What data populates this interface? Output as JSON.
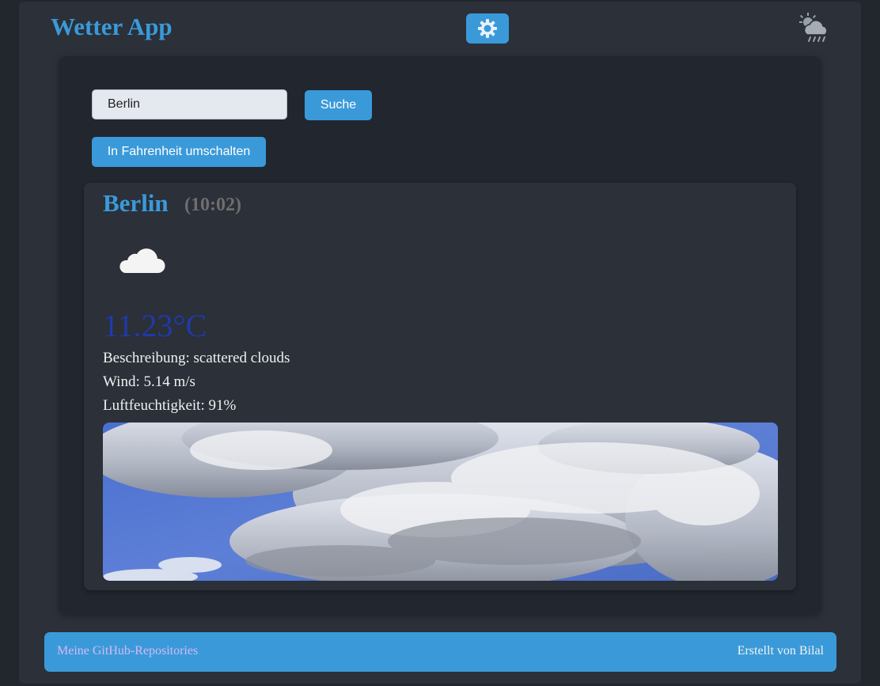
{
  "header": {
    "title": "Wetter App",
    "theme_toggle_icon": "sun-gear-icon",
    "weather_icon": "cloud-sun-rain-icon"
  },
  "search": {
    "value": "Berlin",
    "button_label": "Suche"
  },
  "unit_toggle": {
    "label": "In Fahrenheit umschalten"
  },
  "weather": {
    "city": "Berlin",
    "time": "(10:02)",
    "condition_icon": "cloud-icon",
    "temperature": "11.23°C",
    "description": "Beschreibung: scattered clouds",
    "wind": "Wind: 5.14 m/s",
    "humidity": "Luftfeuchtigkeit: 91%"
  },
  "footer": {
    "link_label": "Meine GitHub-Repositories",
    "credit": "Erstellt von Bilal"
  },
  "colors": {
    "accent": "#3a9ad9",
    "background": "#22262d",
    "panel": "#21262f",
    "card": "#2b3039",
    "temperature": "#1f3aa6",
    "link": "#d6b8f5"
  }
}
